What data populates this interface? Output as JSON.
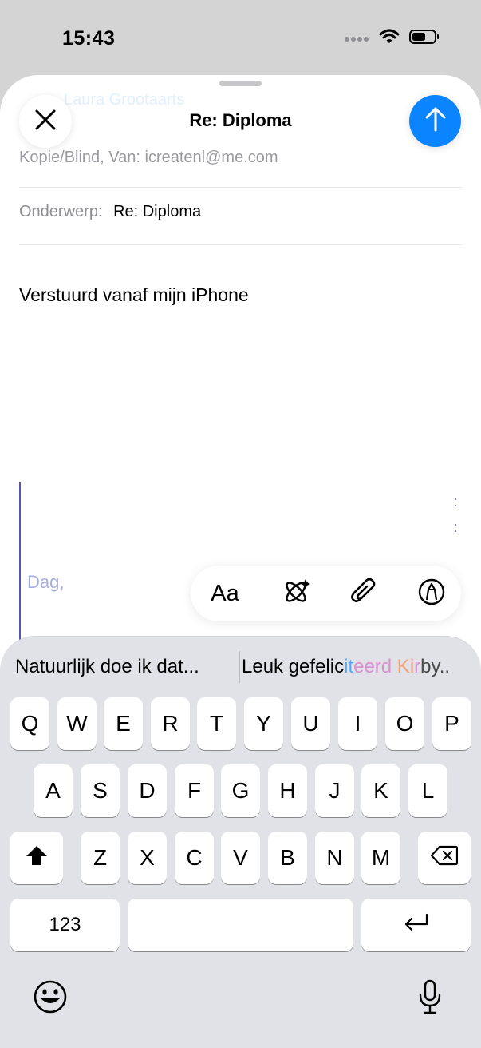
{
  "status_bar": {
    "time": "15:43",
    "icons": [
      "signal-icon",
      "wifi-icon",
      "battery-icon"
    ]
  },
  "compose": {
    "title": "Re: Diploma",
    "ghost_to": "Laura Grootaarts",
    "cc_field": {
      "label": "Kopie/Blind, Van:",
      "value": "icreatenl@me.com"
    },
    "subject_field": {
      "label": "Onderwerp:",
      "value": "Re: Diploma"
    },
    "body": "Verstuurd vanaf mijn iPhone",
    "quoted_greeting": "Dag,",
    "close_icon": "close-icon",
    "send_icon": "arrow-up-icon",
    "accent_color": "#0a84ff"
  },
  "toolbar": {
    "format_label": "Aa",
    "icons": [
      "writing-tools-icon",
      "paperclip-icon",
      "markup-icon"
    ]
  },
  "keyboard": {
    "prediction_left": "Natuurlijk doe ik dat...",
    "prediction_right_parts": [
      "Leuk gefelic",
      "it",
      "eerd",
      " Ki",
      "r",
      "by.."
    ],
    "row1": [
      "Q",
      "W",
      "E",
      "R",
      "T",
      "Y",
      "U",
      "I",
      "O",
      "P"
    ],
    "row2": [
      "A",
      "S",
      "D",
      "F",
      "G",
      "H",
      "J",
      "K",
      "L"
    ],
    "row3": [
      "Z",
      "X",
      "C",
      "V",
      "B",
      "N",
      "M"
    ],
    "numbers_label": "123",
    "icons": [
      "shift-icon",
      "delete-icon",
      "return-icon",
      "emoji-icon",
      "microphone-icon"
    ]
  }
}
